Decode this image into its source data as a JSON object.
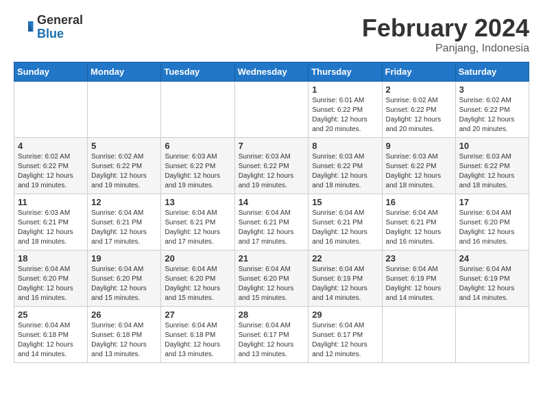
{
  "header": {
    "logo_general": "General",
    "logo_blue": "Blue",
    "month_title": "February 2024",
    "location": "Panjang, Indonesia"
  },
  "days_of_week": [
    "Sunday",
    "Monday",
    "Tuesday",
    "Wednesday",
    "Thursday",
    "Friday",
    "Saturday"
  ],
  "weeks": [
    [
      {
        "day": "",
        "info": ""
      },
      {
        "day": "",
        "info": ""
      },
      {
        "day": "",
        "info": ""
      },
      {
        "day": "",
        "info": ""
      },
      {
        "day": "1",
        "info": "Sunrise: 6:01 AM\nSunset: 6:22 PM\nDaylight: 12 hours\nand 20 minutes."
      },
      {
        "day": "2",
        "info": "Sunrise: 6:02 AM\nSunset: 6:22 PM\nDaylight: 12 hours\nand 20 minutes."
      },
      {
        "day": "3",
        "info": "Sunrise: 6:02 AM\nSunset: 6:22 PM\nDaylight: 12 hours\nand 20 minutes."
      }
    ],
    [
      {
        "day": "4",
        "info": "Sunrise: 6:02 AM\nSunset: 6:22 PM\nDaylight: 12 hours\nand 19 minutes."
      },
      {
        "day": "5",
        "info": "Sunrise: 6:02 AM\nSunset: 6:22 PM\nDaylight: 12 hours\nand 19 minutes."
      },
      {
        "day": "6",
        "info": "Sunrise: 6:03 AM\nSunset: 6:22 PM\nDaylight: 12 hours\nand 19 minutes."
      },
      {
        "day": "7",
        "info": "Sunrise: 6:03 AM\nSunset: 6:22 PM\nDaylight: 12 hours\nand 19 minutes."
      },
      {
        "day": "8",
        "info": "Sunrise: 6:03 AM\nSunset: 6:22 PM\nDaylight: 12 hours\nand 18 minutes."
      },
      {
        "day": "9",
        "info": "Sunrise: 6:03 AM\nSunset: 6:22 PM\nDaylight: 12 hours\nand 18 minutes."
      },
      {
        "day": "10",
        "info": "Sunrise: 6:03 AM\nSunset: 6:22 PM\nDaylight: 12 hours\nand 18 minutes."
      }
    ],
    [
      {
        "day": "11",
        "info": "Sunrise: 6:03 AM\nSunset: 6:21 PM\nDaylight: 12 hours\nand 18 minutes."
      },
      {
        "day": "12",
        "info": "Sunrise: 6:04 AM\nSunset: 6:21 PM\nDaylight: 12 hours\nand 17 minutes."
      },
      {
        "day": "13",
        "info": "Sunrise: 6:04 AM\nSunset: 6:21 PM\nDaylight: 12 hours\nand 17 minutes."
      },
      {
        "day": "14",
        "info": "Sunrise: 6:04 AM\nSunset: 6:21 PM\nDaylight: 12 hours\nand 17 minutes."
      },
      {
        "day": "15",
        "info": "Sunrise: 6:04 AM\nSunset: 6:21 PM\nDaylight: 12 hours\nand 16 minutes."
      },
      {
        "day": "16",
        "info": "Sunrise: 6:04 AM\nSunset: 6:21 PM\nDaylight: 12 hours\nand 16 minutes."
      },
      {
        "day": "17",
        "info": "Sunrise: 6:04 AM\nSunset: 6:20 PM\nDaylight: 12 hours\nand 16 minutes."
      }
    ],
    [
      {
        "day": "18",
        "info": "Sunrise: 6:04 AM\nSunset: 6:20 PM\nDaylight: 12 hours\nand 16 minutes."
      },
      {
        "day": "19",
        "info": "Sunrise: 6:04 AM\nSunset: 6:20 PM\nDaylight: 12 hours\nand 15 minutes."
      },
      {
        "day": "20",
        "info": "Sunrise: 6:04 AM\nSunset: 6:20 PM\nDaylight: 12 hours\nand 15 minutes."
      },
      {
        "day": "21",
        "info": "Sunrise: 6:04 AM\nSunset: 6:20 PM\nDaylight: 12 hours\nand 15 minutes."
      },
      {
        "day": "22",
        "info": "Sunrise: 6:04 AM\nSunset: 6:19 PM\nDaylight: 12 hours\nand 14 minutes."
      },
      {
        "day": "23",
        "info": "Sunrise: 6:04 AM\nSunset: 6:19 PM\nDaylight: 12 hours\nand 14 minutes."
      },
      {
        "day": "24",
        "info": "Sunrise: 6:04 AM\nSunset: 6:19 PM\nDaylight: 12 hours\nand 14 minutes."
      }
    ],
    [
      {
        "day": "25",
        "info": "Sunrise: 6:04 AM\nSunset: 6:18 PM\nDaylight: 12 hours\nand 14 minutes."
      },
      {
        "day": "26",
        "info": "Sunrise: 6:04 AM\nSunset: 6:18 PM\nDaylight: 12 hours\nand 13 minutes."
      },
      {
        "day": "27",
        "info": "Sunrise: 6:04 AM\nSunset: 6:18 PM\nDaylight: 12 hours\nand 13 minutes."
      },
      {
        "day": "28",
        "info": "Sunrise: 6:04 AM\nSunset: 6:17 PM\nDaylight: 12 hours\nand 13 minutes."
      },
      {
        "day": "29",
        "info": "Sunrise: 6:04 AM\nSunset: 6:17 PM\nDaylight: 12 hours\nand 12 minutes."
      },
      {
        "day": "",
        "info": ""
      },
      {
        "day": "",
        "info": ""
      }
    ]
  ]
}
